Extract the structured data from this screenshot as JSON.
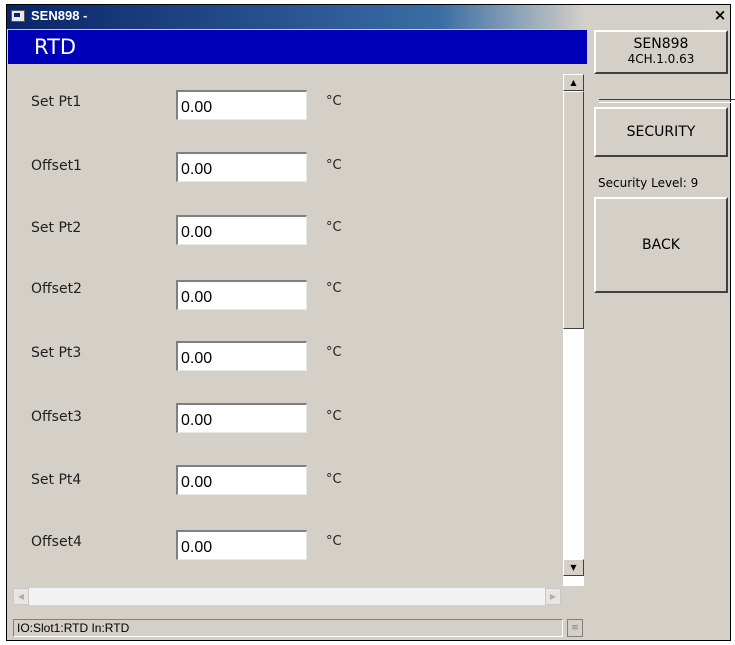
{
  "window": {
    "title": "SEN898 -",
    "close_glyph": "×"
  },
  "panel": {
    "title": "RTD"
  },
  "rows": [
    {
      "label": "Set Pt1",
      "value": "0.00",
      "unit": "°C"
    },
    {
      "label": "Offset1",
      "value": "0.00",
      "unit": "°C"
    },
    {
      "label": "Set Pt2",
      "value": "0.00",
      "unit": "°C"
    },
    {
      "label": "Offset2",
      "value": "0.00",
      "unit": "°C"
    },
    {
      "label": "Set Pt3",
      "value": "0.00",
      "unit": "°C"
    },
    {
      "label": "Offset3",
      "value": "0.00",
      "unit": "°C"
    },
    {
      "label": "Set Pt4",
      "value": "0.00",
      "unit": "°C"
    },
    {
      "label": "Offset4",
      "value": "0.00",
      "unit": "°C"
    }
  ],
  "side": {
    "device_line1": "SEN898",
    "device_line2": "4CH.1.0.63",
    "security_button": "SECURITY",
    "security_level": "Security Level: 9",
    "back_button": "BACK"
  },
  "status": {
    "text": "IO:Slot1:RTD In:RTD"
  },
  "icons": {
    "scroll_up": "▲",
    "scroll_down": "▼",
    "scroll_left": "◀",
    "scroll_right": "▶",
    "spin": "≡"
  },
  "colors": {
    "panel_header": "#0000b8",
    "window_bg": "#d4d0c8",
    "titlebar": "#0a246a"
  }
}
